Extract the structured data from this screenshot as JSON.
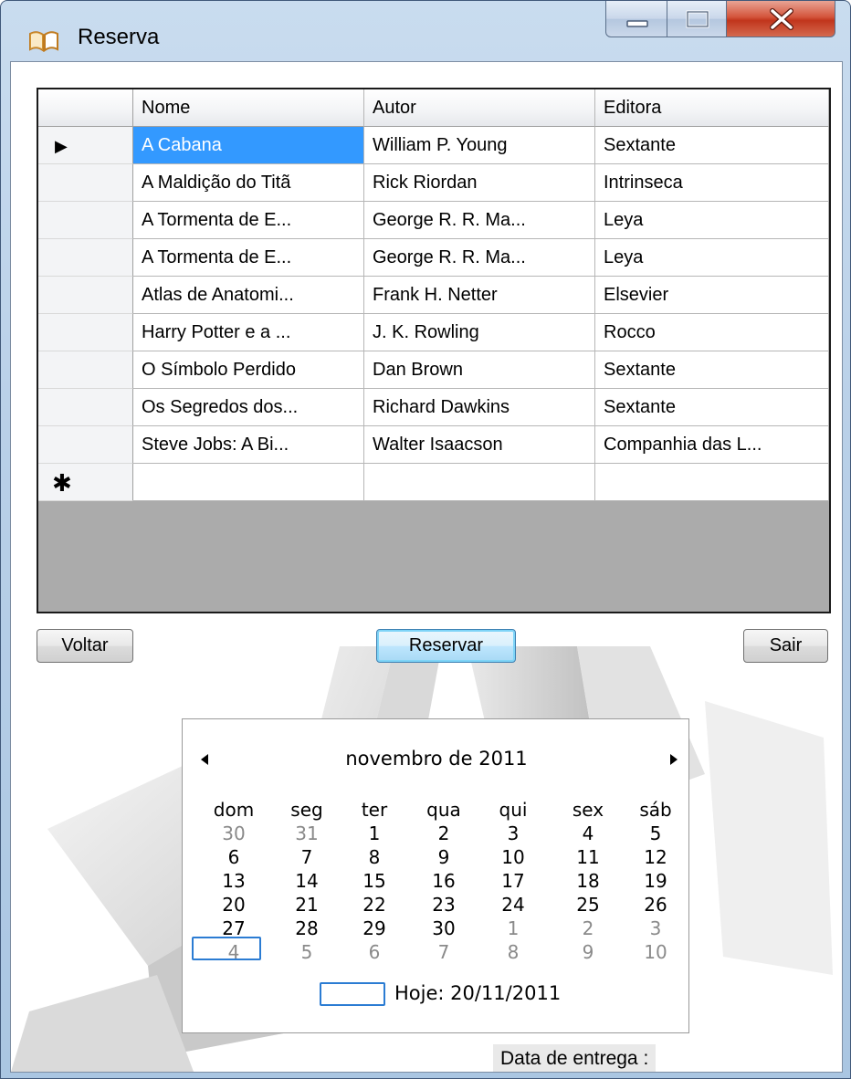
{
  "window": {
    "title": "Reserva",
    "icon": "book-icon",
    "controls": [
      "minimize-icon",
      "maximize-icon",
      "close-icon"
    ]
  },
  "grid": {
    "columns": [
      "Nome",
      "Autor",
      "Editora"
    ],
    "rows": [
      {
        "marker": "▶",
        "cells": [
          "A Cabana",
          "William P. Young",
          "Sextante"
        ]
      },
      {
        "marker": "",
        "cells": [
          "A Maldição do Titã",
          "Rick Riordan",
          "Intrinseca"
        ]
      },
      {
        "marker": "",
        "cells": [
          "A Tormenta de E...",
          "George R. R. Ma...",
          "Leya"
        ]
      },
      {
        "marker": "",
        "cells": [
          "A Tormenta de E...",
          "George R. R. Ma...",
          "Leya"
        ]
      },
      {
        "marker": "",
        "cells": [
          "Atlas de Anatomi...",
          "Frank H. Netter",
          "Elsevier"
        ]
      },
      {
        "marker": "",
        "cells": [
          "Harry Potter e a ...",
          "J. K. Rowling",
          "Rocco"
        ]
      },
      {
        "marker": "",
        "cells": [
          "O Símbolo Perdido",
          "Dan Brown",
          "Sextante"
        ]
      },
      {
        "marker": "",
        "cells": [
          "Os Segredos dos...",
          "Richard Dawkins",
          "Sextante"
        ]
      },
      {
        "marker": "",
        "cells": [
          "Steve Jobs: A Bi...",
          "Walter Isaacson",
          "Companhia das L..."
        ]
      }
    ],
    "new_row_marker": "✱",
    "selected_row": 0
  },
  "buttons": {
    "back": "Voltar",
    "reserve": "Reservar",
    "exit": "Sair"
  },
  "calendar": {
    "month_label": "novembro de 2011",
    "weekdays": [
      "dom",
      "seg",
      "ter",
      "qua",
      "qui",
      "sex",
      "sáb"
    ],
    "weeks": [
      [
        {
          "d": "30",
          "m": true
        },
        {
          "d": "31",
          "m": true
        },
        {
          "d": "1"
        },
        {
          "d": "2"
        },
        {
          "d": "3"
        },
        {
          "d": "4"
        },
        {
          "d": "5"
        }
      ],
      [
        {
          "d": "6"
        },
        {
          "d": "7"
        },
        {
          "d": "8"
        },
        {
          "d": "9"
        },
        {
          "d": "10"
        },
        {
          "d": "11"
        },
        {
          "d": "12"
        }
      ],
      [
        {
          "d": "13"
        },
        {
          "d": "14"
        },
        {
          "d": "15"
        },
        {
          "d": "16"
        },
        {
          "d": "17"
        },
        {
          "d": "18"
        },
        {
          "d": "19"
        }
      ],
      [
        {
          "d": "20"
        },
        {
          "d": "21"
        },
        {
          "d": "22"
        },
        {
          "d": "23"
        },
        {
          "d": "24"
        },
        {
          "d": "25"
        },
        {
          "d": "26"
        }
      ],
      [
        {
          "d": "27"
        },
        {
          "d": "28"
        },
        {
          "d": "29"
        },
        {
          "d": "30"
        },
        {
          "d": "1",
          "m": true
        },
        {
          "d": "2",
          "m": true
        },
        {
          "d": "3",
          "m": true
        }
      ],
      [
        {
          "d": "4",
          "m": true
        },
        {
          "d": "5",
          "m": true
        },
        {
          "d": "6",
          "m": true
        },
        {
          "d": "7",
          "m": true
        },
        {
          "d": "8",
          "m": true
        },
        {
          "d": "9",
          "m": true
        },
        {
          "d": "10",
          "m": true
        }
      ]
    ],
    "today_label": "Hoje: 20/11/2011",
    "prev_icon": "triangle-left-icon",
    "next_icon": "triangle-right-icon"
  },
  "delivery": {
    "label": "Data de entrega :"
  },
  "colors": {
    "selection": "#3399ff",
    "grid_background": "#ababab",
    "today_outline": "#2b7cd3",
    "close_button": "#c1351c"
  }
}
